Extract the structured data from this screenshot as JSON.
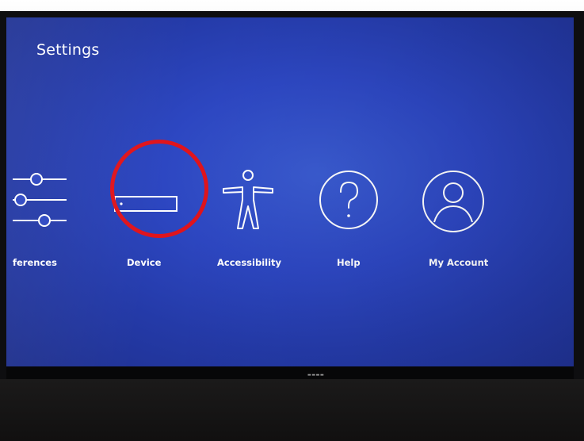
{
  "screen": {
    "title": "Settings",
    "tiles": [
      {
        "label": "ferences",
        "icon": "sliders-icon"
      },
      {
        "label": "Device",
        "icon": "device-icon"
      },
      {
        "label": "Accessibility",
        "icon": "accessibility-icon"
      },
      {
        "label": "Help",
        "icon": "help-icon"
      },
      {
        "label": "My Account",
        "icon": "account-icon"
      }
    ],
    "background_color": "#2d47c2",
    "highlight_color": "#e0141c"
  }
}
